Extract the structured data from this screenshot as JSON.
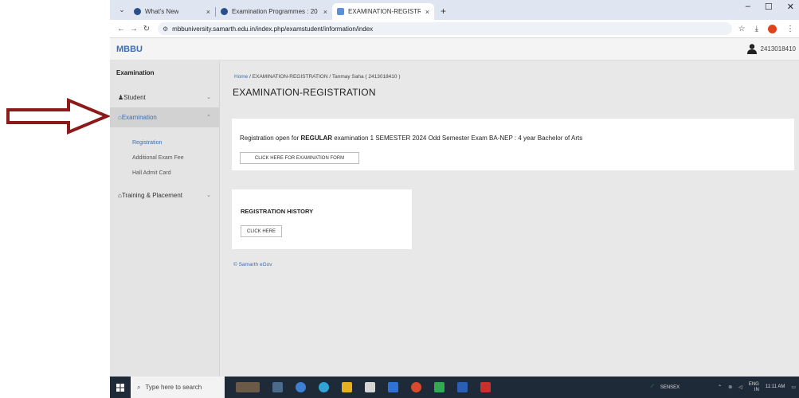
{
  "tabs": [
    {
      "title": "What's New",
      "favicon_color": "#2b4f8a",
      "close": "×"
    },
    {
      "title": "Examination Programmes : 20",
      "favicon_color": "#2b4f8a",
      "close": "×"
    },
    {
      "title": "EXAMINATION-REGISTRATION",
      "favicon_color": "#5b8fd9",
      "close": "×"
    }
  ],
  "newtab_label": "+",
  "window_controls": {
    "minimize": "–",
    "maximize": "☐",
    "close": "✕"
  },
  "address": {
    "url": "mbbuniversity.samarth.edu.in/index.php/examstudent/information/index"
  },
  "site": {
    "brand": "MBBU",
    "user_id": "2413018410"
  },
  "sidebar": {
    "title": "Examination",
    "items": [
      {
        "label": "Student",
        "chevron": "⌄"
      },
      {
        "label": "Examination",
        "chevron": "⌃"
      },
      {
        "label": "Training & Placement",
        "chevron": "⌄"
      }
    ],
    "subitems": [
      "Registration",
      "Additional Exam Fee",
      "Hall Admit Card"
    ]
  },
  "breadcrumb": {
    "home": "Home",
    "sep1": "/",
    "section": "EXAMINATION-REGISTRATION",
    "sep2": "/",
    "student": "Tanmay Saha ( 2413018410 )"
  },
  "page_title": "EXAMINATION-REGISTRATION",
  "registration": {
    "prefix": "Registration open for ",
    "type": "REGULAR",
    "suffix": " examination 1 SEMESTER 2024 Odd Semester Exam BA-NEP : 4 year Bachelor of Arts",
    "button": "CLICK HERE FOR EXAMINATION FORM"
  },
  "history": {
    "title": "REGISTRATION HISTORY",
    "button": "CLICK HERE"
  },
  "footer": "© Samarth eGov",
  "taskbar": {
    "search_placeholder": "Type here to search",
    "sensex": "SENSEX",
    "lang": "ENG",
    "lang_sub": "IN",
    "time": "11:11 AM"
  },
  "colors": {
    "accent": "#3c6fb6",
    "annotation_arrow": "#8b1a1a"
  }
}
